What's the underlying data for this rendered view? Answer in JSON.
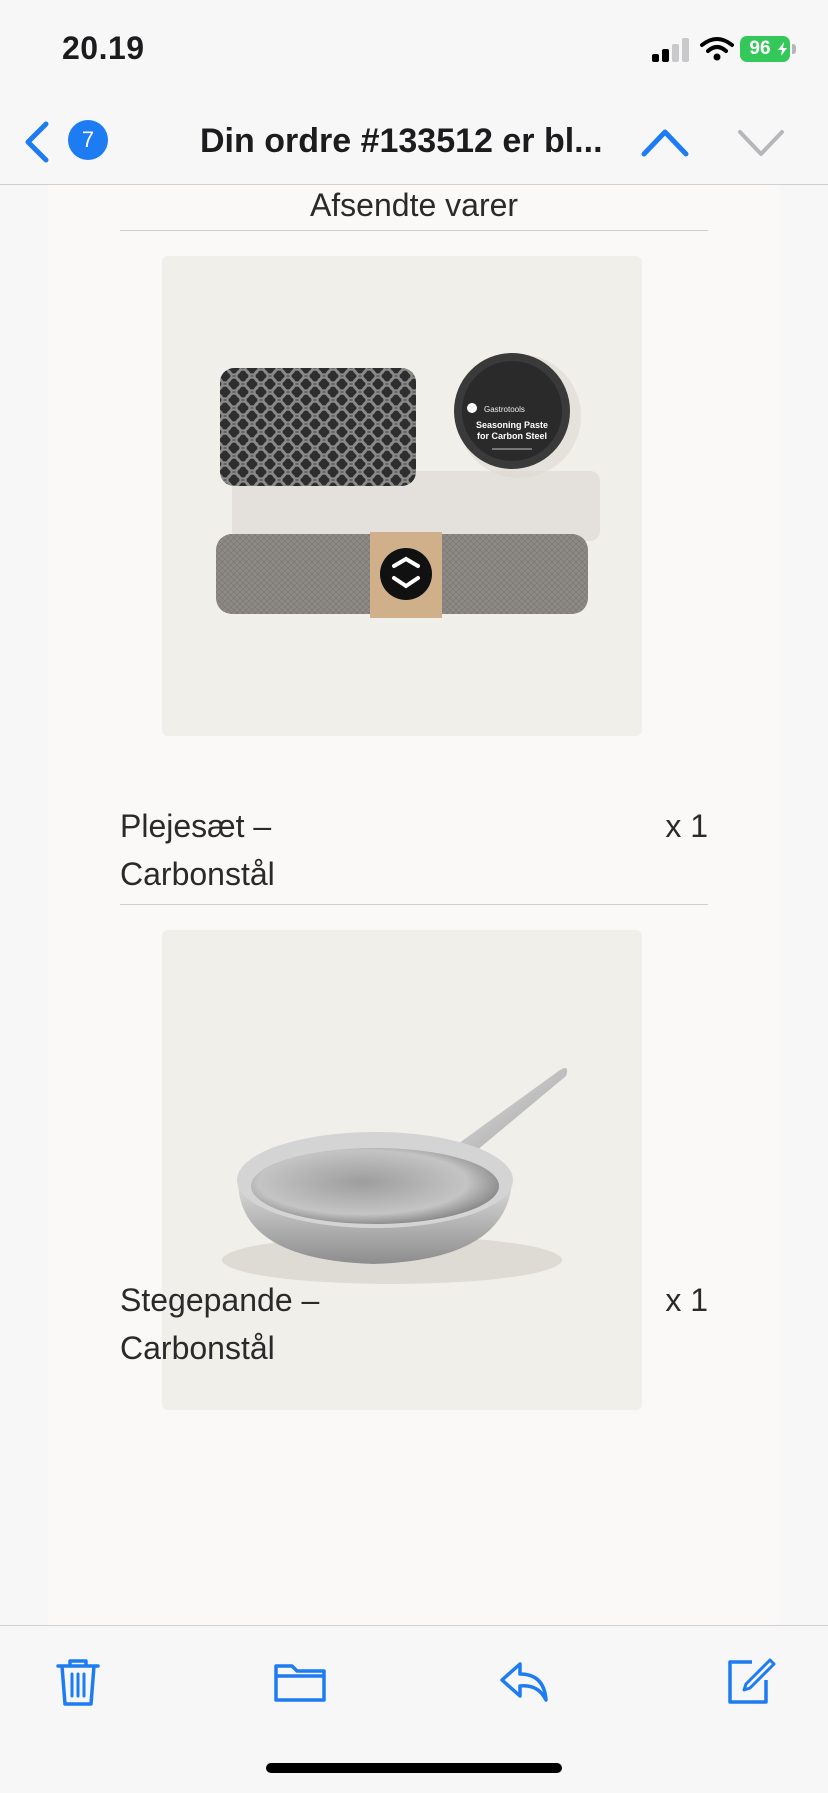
{
  "status_bar": {
    "time": "20.19",
    "battery": "96",
    "accent_color": "#34c759"
  },
  "nav": {
    "back_icon": "chevron-left-icon",
    "unread_count": "7",
    "title": "Din ordre #133512 er bl...",
    "prev_icon": "chevron-up-icon",
    "next_icon": "chevron-down-icon",
    "accent_color": "#1e7cf2"
  },
  "email": {
    "section_title": "Afsendte varer",
    "items": [
      {
        "name": "Plejesæt – Carbonstål",
        "qty": "x 1",
        "image": "care-set-image"
      },
      {
        "name": "Stegepande – Carbonstål",
        "qty": "x 1",
        "image": "frying-pan-image"
      }
    ],
    "package_label": {
      "brand": "Gastrotools",
      "line1": "Seasoning Paste",
      "line2": "for Carbon Steel"
    }
  },
  "toolbar": {
    "icons": [
      "trash-icon",
      "folder-icon",
      "reply-icon",
      "compose-icon"
    ]
  }
}
